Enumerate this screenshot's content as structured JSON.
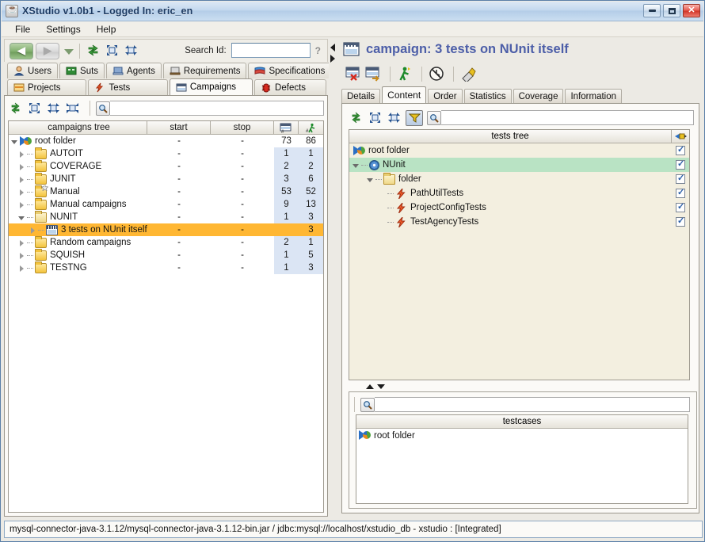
{
  "window": {
    "title": "XStudio v1.0b1 - Logged In: eric_en",
    "app_icon": "java-cup-icon",
    "controls": {
      "minimize": "minimize-button",
      "maximize": "maximize-button",
      "close": "close-button"
    }
  },
  "menubar": {
    "items": [
      "File",
      "Settings",
      "Help"
    ]
  },
  "toolbar": {
    "back": "◀",
    "forward": "▶",
    "dropdown": "history-dropdown",
    "icons": [
      "refresh-tree-icon",
      "expand-all-icon",
      "collapse-all-icon"
    ],
    "search_label": "Search Id:",
    "search_value": "",
    "help_marker": "?"
  },
  "main_tabs": {
    "row1": [
      {
        "label": "Users",
        "icon": "user-icon",
        "active": false
      },
      {
        "label": "Suts",
        "icon": "sut-icon",
        "active": false
      },
      {
        "label": "Agents",
        "icon": "agent-icon",
        "active": false
      },
      {
        "label": "Requirements",
        "icon": "requirement-icon",
        "active": false
      },
      {
        "label": "Specifications",
        "icon": "specification-icon",
        "active": false
      }
    ],
    "row2": [
      {
        "label": "Projects",
        "icon": "project-icon",
        "active": false
      },
      {
        "label": "Tests",
        "icon": "test-icon",
        "active": false
      },
      {
        "label": "Campaigns",
        "icon": "campaign-icon",
        "active": true
      },
      {
        "label": "Defects",
        "icon": "defect-icon",
        "active": false
      }
    ]
  },
  "campaign_tree": {
    "toolbar_icons": [
      "refresh-icon",
      "expand-all-icon",
      "collapse-all-icon",
      "collapse-node-icon"
    ],
    "filter_value": "",
    "columns": [
      "campaigns tree",
      "start",
      "stop",
      "campaign-count-icon",
      "run-count-icon"
    ],
    "rows": [
      {
        "label": "root folder",
        "icon": "root-folder-icon",
        "indent": 0,
        "twisty": "open",
        "start": "-",
        "stop": "-",
        "count1": "73",
        "count2": "86",
        "selected": false,
        "root": true
      },
      {
        "label": "AUTOIT",
        "icon": "folder-icon",
        "indent": 1,
        "twisty": "closed",
        "start": "-",
        "stop": "-",
        "count1": "1",
        "count2": "1",
        "selected": false,
        "root": false
      },
      {
        "label": "COVERAGE",
        "icon": "folder-icon",
        "indent": 1,
        "twisty": "closed",
        "start": "-",
        "stop": "-",
        "count1": "2",
        "count2": "2",
        "selected": false,
        "root": false
      },
      {
        "label": "JUNIT",
        "icon": "folder-icon",
        "indent": 1,
        "twisty": "closed",
        "start": "-",
        "stop": "-",
        "count1": "3",
        "count2": "6",
        "selected": false,
        "root": false
      },
      {
        "label": "Manual",
        "icon": "folder-star-icon",
        "indent": 1,
        "twisty": "closed",
        "start": "-",
        "stop": "-",
        "count1": "53",
        "count2": "52",
        "selected": false,
        "root": false
      },
      {
        "label": "Manual campaigns",
        "icon": "folder-icon",
        "indent": 1,
        "twisty": "closed",
        "start": "-",
        "stop": "-",
        "count1": "9",
        "count2": "13",
        "selected": false,
        "root": false
      },
      {
        "label": "NUNIT",
        "icon": "folder-open-icon",
        "indent": 1,
        "twisty": "open",
        "start": "-",
        "stop": "-",
        "count1": "1",
        "count2": "3",
        "selected": false,
        "root": false
      },
      {
        "label": "3 tests on NUnit itself",
        "icon": "campaign-icon",
        "indent": 2,
        "twisty": "closed",
        "start": "-",
        "stop": "-",
        "count1": "",
        "count2": "3",
        "selected": true,
        "root": false
      },
      {
        "label": "Random campaigns",
        "icon": "folder-icon",
        "indent": 1,
        "twisty": "closed",
        "start": "-",
        "stop": "-",
        "count1": "2",
        "count2": "1",
        "selected": false,
        "root": false
      },
      {
        "label": "SQUISH",
        "icon": "folder-icon",
        "indent": 1,
        "twisty": "closed",
        "start": "-",
        "stop": "-",
        "count1": "1",
        "count2": "5",
        "selected": false,
        "root": false
      },
      {
        "label": "TESTNG",
        "icon": "folder-icon",
        "indent": 1,
        "twisty": "closed",
        "start": "-",
        "stop": "-",
        "count1": "1",
        "count2": "3",
        "selected": false,
        "root": false
      }
    ]
  },
  "splitters": {
    "vertical": {
      "collapse_left": "collapse-left-arrow",
      "collapse_right": "collapse-right-arrow"
    },
    "horizontal": {
      "collapse_up": "collapse-up-arrow",
      "collapse_down": "collapse-down-arrow"
    }
  },
  "detail": {
    "title": "campaign: 3 tests on NUnit itself",
    "title_icon": "campaign-icon",
    "toolbar_icons": [
      "delete-campaign-icon",
      "export-campaign-icon",
      "run-campaign-icon",
      "schedule-campaign-icon",
      "publish-campaign-icon"
    ],
    "tabs": [
      {
        "label": "Details",
        "active": false
      },
      {
        "label": "Content",
        "active": true
      },
      {
        "label": "Order",
        "active": false
      },
      {
        "label": "Statistics",
        "active": false
      },
      {
        "label": "Coverage",
        "active": false
      },
      {
        "label": "Information",
        "active": false
      }
    ]
  },
  "tests_tree": {
    "toolbar_icons": [
      "refresh-icon",
      "expand-all-icon",
      "collapse-all-icon"
    ],
    "filter_toggle": "filter-toggle-icon",
    "filter_value": "",
    "column_header": "tests tree",
    "column_header_icon": "select-all-icon",
    "rows": [
      {
        "label": "root folder",
        "icon": "root-folder-icon",
        "indent": 0,
        "twisty": "none",
        "checked": true,
        "selected": false
      },
      {
        "label": "NUnit",
        "icon": "gear-icon",
        "indent": 1,
        "twisty": "open",
        "checked": true,
        "selected": true
      },
      {
        "label": "folder",
        "icon": "folder-open-icon",
        "indent": 2,
        "twisty": "open",
        "checked": true,
        "selected": false
      },
      {
        "label": "PathUtilTests",
        "icon": "test-icon",
        "indent": 3,
        "twisty": "none",
        "checked": true,
        "selected": false
      },
      {
        "label": "ProjectConfigTests",
        "icon": "test-icon",
        "indent": 3,
        "twisty": "none",
        "checked": true,
        "selected": false
      },
      {
        "label": "TestAgencyTests",
        "icon": "test-icon",
        "indent": 3,
        "twisty": "none",
        "checked": true,
        "selected": false
      }
    ]
  },
  "testcases": {
    "filter_value": "",
    "column_header": "testcases",
    "rows": [
      {
        "label": "root folder",
        "icon": "root-folder-icon"
      }
    ]
  },
  "statusbar": {
    "text": "mysql-connector-java-3.1.12/mysql-connector-java-3.1.12-bin.jar / jdbc:mysql://localhost/xstudio_db - xstudio : [Integrated]"
  },
  "colors": {
    "selection_orange": "#ffb733",
    "selection_green": "#b9e3c4",
    "title_blue": "#4c5ea8",
    "count_column": "#dbe5f4",
    "tests_bg": "#f3efe0"
  }
}
